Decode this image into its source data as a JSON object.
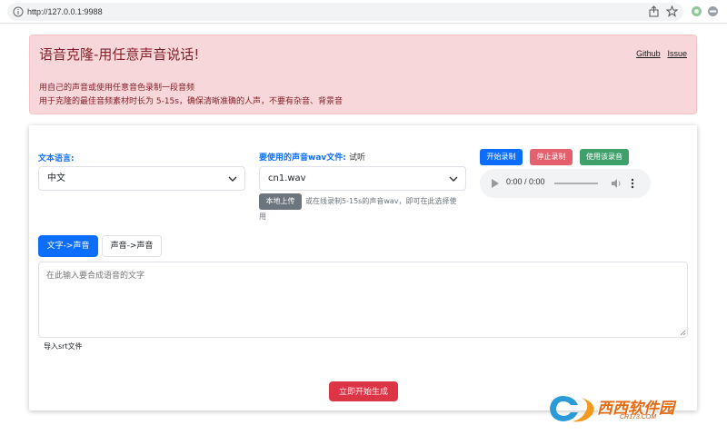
{
  "browser": {
    "url": "http://127.0.0.1:9988"
  },
  "header": {
    "title": "语音克隆-用任意声音说话!",
    "links": [
      "Github",
      "Issue"
    ],
    "desc1": "用自己的声音或使用任意音色录制一段音频",
    "desc2": "用于克隆的最佳音频素材时长为 5-15s，确保清晰准确的人声，不要有杂音、背景音"
  },
  "form": {
    "language_label": "文本语言:",
    "language_value": "中文",
    "voice_label": "要使用的声音wav文件:",
    "voice_listen": "试听",
    "voice_value": "cn1.wav",
    "upload_button": "本地上传",
    "upload_note": "或在线录制5-15s的声音wav，即可在此选择使",
    "upload_note2": "用",
    "record_start": "开始录制",
    "record_stop": "停止录制",
    "record_use": "使用该录音",
    "audio_time": "0:00 / 0:00",
    "tabs": [
      {
        "label": "文字->声音"
      },
      {
        "label": "声音->声音"
      }
    ],
    "text_placeholder": "在此输入要合成语音的文字",
    "import_srt": "导入srt文件",
    "generate_button": "立即开始生成"
  },
  "watermark": {
    "text": "西西软件园",
    "sub": "CR173.COM"
  },
  "colors": {
    "primary": "#0d6efd",
    "danger": "#dc3545",
    "alert_bg": "#f8d7da",
    "alert_text": "#842029"
  }
}
